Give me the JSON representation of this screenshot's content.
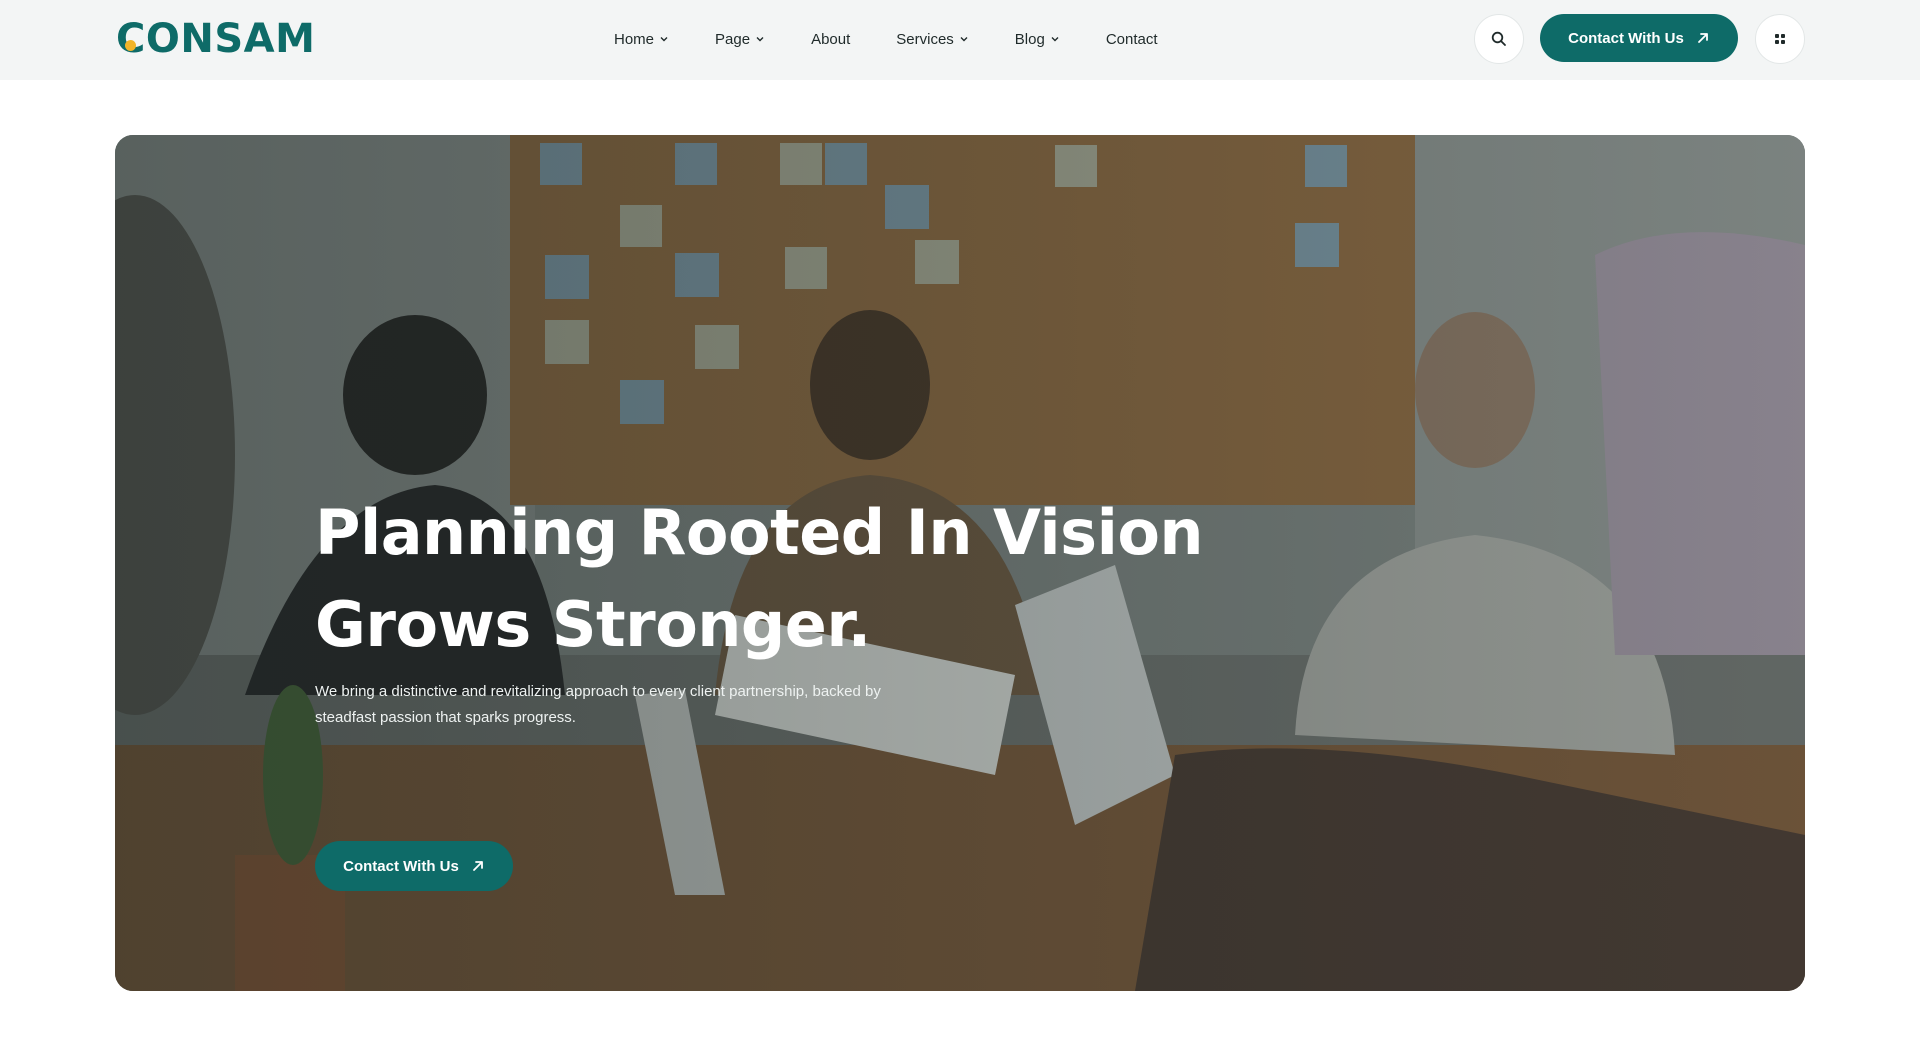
{
  "brand": {
    "name_rest": "ONSAM",
    "name_first": "C",
    "accent": "#0e6b68",
    "dot_color": "#f0b429"
  },
  "nav": [
    {
      "label": "Home",
      "has_dropdown": true
    },
    {
      "label": "Page",
      "has_dropdown": true
    },
    {
      "label": "About",
      "has_dropdown": false
    },
    {
      "label": "Services",
      "has_dropdown": true
    },
    {
      "label": "Blog",
      "has_dropdown": true
    },
    {
      "label": "Contact",
      "has_dropdown": false
    }
  ],
  "header": {
    "search_icon": "search-icon",
    "cta_label": "Contact With Us",
    "cta_icon": "arrow-up-right-icon",
    "menu_icon": "grid-icon"
  },
  "hero": {
    "title_line1": "Planning Rooted In Vision",
    "title_line2": "Grows Stronger.",
    "subtitle_line1": "We bring a distinctive and revitalizing approach to every client partnership, backed by",
    "subtitle_line2": "steadfast passion that sparks progress.",
    "cta_label": "Contact With Us",
    "cta_icon": "arrow-up-right-icon"
  }
}
